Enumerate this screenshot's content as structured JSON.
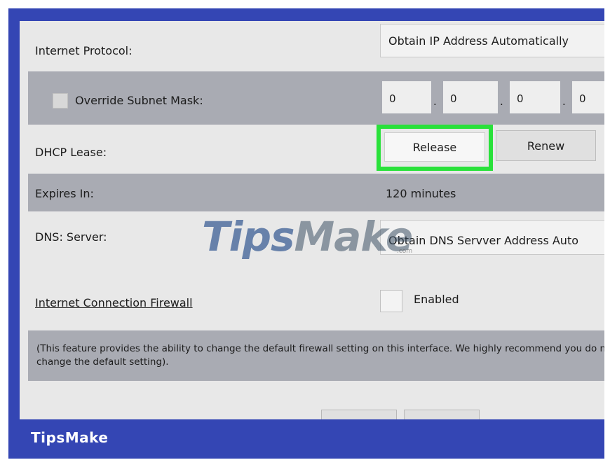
{
  "ip": {
    "label": "Internet Protocol:",
    "value": "Obtain IP Address Automatically"
  },
  "subnet": {
    "checkbox_label": "Override Subnet Mask:",
    "octets": [
      "0",
      "0",
      "0",
      "0"
    ],
    "separator": "."
  },
  "dhcp": {
    "label": "DHCP Lease:",
    "release_label": "Release",
    "renew_label": "Renew",
    "highlight_color": "#29e13a"
  },
  "expires": {
    "label": "Expires In:",
    "value": "120 minutes"
  },
  "dns": {
    "label": "DNS: Server:",
    "value": "Obtain DNS Servver Address Auto"
  },
  "firewall": {
    "link_label": "Internet Connection Firewall",
    "enabled_label": "Enabled",
    "note": "(This feature provides the ability to change the default firewall setting on this interface. We highly recommend you do not change the default setting)."
  },
  "watermark": {
    "tips": "Tips",
    "make": "Make",
    "com": ".com"
  },
  "footer": {
    "brand": "TipsMake",
    "frame_color": "#3446b4"
  }
}
